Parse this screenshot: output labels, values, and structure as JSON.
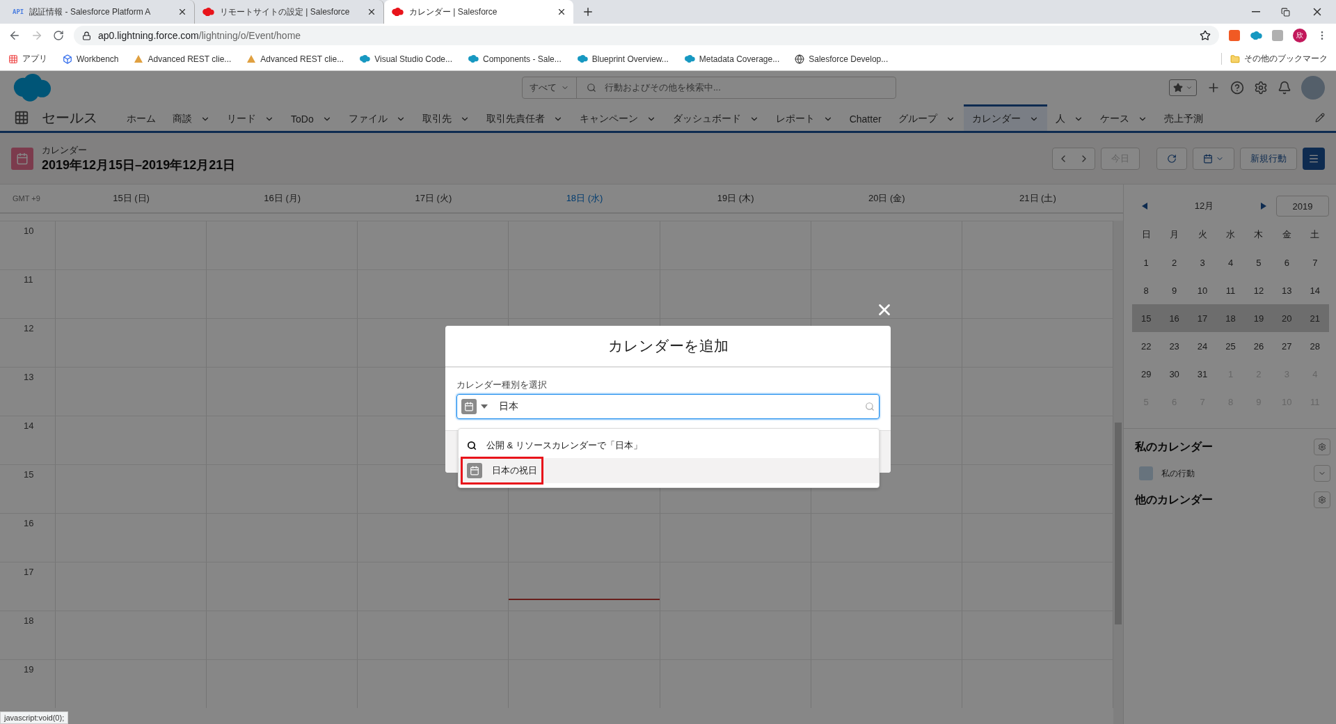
{
  "browser": {
    "tabs": [
      {
        "kind": "api",
        "badge": "API",
        "title": "認証情報 - Salesforce Platform A",
        "selected": false
      },
      {
        "kind": "cloud",
        "title": "リモートサイトの設定 | Salesforce",
        "selected": false
      },
      {
        "kind": "cloud",
        "title": "カレンダー | Salesforce",
        "selected": true
      }
    ],
    "url_host": "ap0.lightning.force.com",
    "url_path": "/lightning/o/Event/home",
    "profile": "欣",
    "bookmarks": [
      {
        "kind": "apps",
        "label": "アプリ"
      },
      {
        "kind": "cube",
        "label": "Workbench"
      },
      {
        "kind": "rest",
        "label": "Advanced REST clie..."
      },
      {
        "kind": "rest",
        "label": "Advanced REST clie..."
      },
      {
        "kind": "cloud",
        "label": "Visual Studio Code..."
      },
      {
        "kind": "cloud",
        "label": "Components - Sale..."
      },
      {
        "kind": "cloud",
        "label": "Blueprint Overview..."
      },
      {
        "kind": "cloud",
        "label": "Metadata Coverage..."
      },
      {
        "kind": "globe",
        "label": "Salesforce Develop..."
      }
    ],
    "other_bookmarks": "その他のブックマーク"
  },
  "app": {
    "name": "セールス",
    "search": {
      "scope": "すべて",
      "placeholder": "行動およびその他を検索中..."
    },
    "nav": [
      {
        "label": "ホーム",
        "menu": false,
        "selected": false
      },
      {
        "label": "商談",
        "menu": true,
        "selected": false
      },
      {
        "label": "リード",
        "menu": true,
        "selected": false
      },
      {
        "label": "ToDo",
        "menu": true,
        "selected": false
      },
      {
        "label": "ファイル",
        "menu": true,
        "selected": false
      },
      {
        "label": "取引先",
        "menu": true,
        "selected": false
      },
      {
        "label": "取引先責任者",
        "menu": true,
        "selected": false
      },
      {
        "label": "キャンペーン",
        "menu": true,
        "selected": false
      },
      {
        "label": "ダッシュボード",
        "menu": true,
        "selected": false
      },
      {
        "label": "レポート",
        "menu": true,
        "selected": false
      },
      {
        "label": "Chatter",
        "menu": false,
        "selected": false
      },
      {
        "label": "グループ",
        "menu": true,
        "selected": false
      },
      {
        "label": "カレンダー",
        "menu": true,
        "selected": true
      },
      {
        "label": "人",
        "menu": true,
        "selected": false
      },
      {
        "label": "ケース",
        "menu": true,
        "selected": false
      },
      {
        "label": "売上予測",
        "menu": false,
        "selected": false
      }
    ]
  },
  "header": {
    "object": "カレンダー",
    "title": "2019年12月15日–2019年12月21日",
    "today_button": "今日",
    "new_button": "新規行動"
  },
  "week": {
    "timezone": "GMT +9",
    "days": [
      {
        "label": "15日 (日)",
        "today": false
      },
      {
        "label": "16日 (月)",
        "today": false
      },
      {
        "label": "17日 (火)",
        "today": false
      },
      {
        "label": "18日 (水)",
        "today": true
      },
      {
        "label": "19日 (木)",
        "today": false
      },
      {
        "label": "20日 (金)",
        "today": false
      },
      {
        "label": "21日 (土)",
        "today": false
      }
    ],
    "hours": [
      "10",
      "11",
      "12",
      "13",
      "14",
      "15",
      "16",
      "17",
      "18",
      "19"
    ]
  },
  "sidebar": {
    "month": "12月",
    "year": "2019",
    "weekdays": [
      "日",
      "月",
      "火",
      "水",
      "木",
      "金",
      "土"
    ],
    "weeks": [
      {
        "selected": false,
        "days": [
          {
            "label": "1",
            "muted": false
          },
          {
            "label": "2",
            "muted": false
          },
          {
            "label": "3",
            "muted": false
          },
          {
            "label": "4",
            "muted": false
          },
          {
            "label": "5",
            "muted": false
          },
          {
            "label": "6",
            "muted": false
          },
          {
            "label": "7",
            "muted": false
          }
        ]
      },
      {
        "selected": false,
        "days": [
          {
            "label": "8",
            "muted": false
          },
          {
            "label": "9",
            "muted": false
          },
          {
            "label": "10",
            "muted": false
          },
          {
            "label": "11",
            "muted": false
          },
          {
            "label": "12",
            "muted": false
          },
          {
            "label": "13",
            "muted": false
          },
          {
            "label": "14",
            "muted": false
          }
        ]
      },
      {
        "selected": true,
        "days": [
          {
            "label": "15",
            "muted": false
          },
          {
            "label": "16",
            "muted": false
          },
          {
            "label": "17",
            "muted": false
          },
          {
            "label": "18",
            "muted": false
          },
          {
            "label": "19",
            "muted": false
          },
          {
            "label": "20",
            "muted": false
          },
          {
            "label": "21",
            "muted": false
          }
        ]
      },
      {
        "selected": false,
        "days": [
          {
            "label": "22",
            "muted": false
          },
          {
            "label": "23",
            "muted": false
          },
          {
            "label": "24",
            "muted": false
          },
          {
            "label": "25",
            "muted": false
          },
          {
            "label": "26",
            "muted": false
          },
          {
            "label": "27",
            "muted": false
          },
          {
            "label": "28",
            "muted": false
          }
        ]
      },
      {
        "selected": false,
        "days": [
          {
            "label": "29",
            "muted": false
          },
          {
            "label": "30",
            "muted": false
          },
          {
            "label": "31",
            "muted": false
          },
          {
            "label": "1",
            "muted": true
          },
          {
            "label": "2",
            "muted": true
          },
          {
            "label": "3",
            "muted": true
          },
          {
            "label": "4",
            "muted": true
          }
        ]
      },
      {
        "selected": false,
        "days": [
          {
            "label": "5",
            "muted": true
          },
          {
            "label": "6",
            "muted": true
          },
          {
            "label": "7",
            "muted": true
          },
          {
            "label": "8",
            "muted": true
          },
          {
            "label": "9",
            "muted": true
          },
          {
            "label": "10",
            "muted": true
          },
          {
            "label": "11",
            "muted": true
          }
        ]
      }
    ],
    "my_title": "私のカレンダー",
    "my_items": [
      {
        "label": "私の行動"
      }
    ],
    "other_title": "他のカレンダー"
  },
  "modal": {
    "title": "カレンダーを追加",
    "field_label": "カレンダー種別を選択",
    "value": "日本",
    "options": [
      {
        "kind": "search",
        "label": "公開 & リソースカレンダーで「日本」",
        "highlighted": false
      },
      {
        "kind": "calendar",
        "label": "日本の祝日",
        "highlighted": true
      }
    ]
  },
  "status_bar": "javascript:void(0);"
}
